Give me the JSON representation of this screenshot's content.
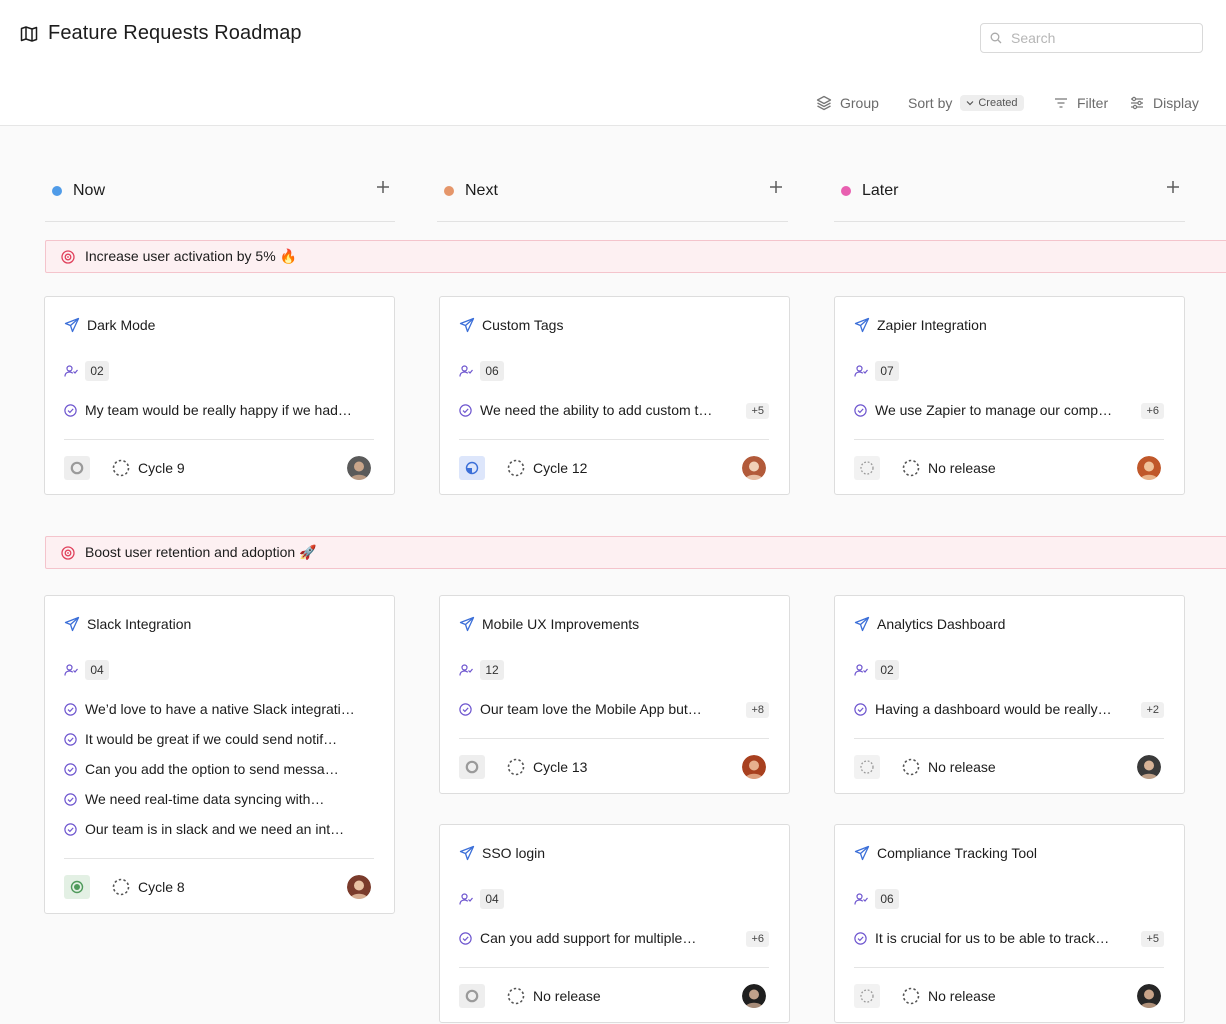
{
  "header": {
    "title": "Feature Requests Roadmap",
    "search_placeholder": "Search"
  },
  "toolbar": {
    "group": "Group",
    "sort_by": "Sort by",
    "sort_value": "Created",
    "filter": "Filter",
    "display": "Display"
  },
  "columns": [
    {
      "name": "Now",
      "color": "#4f9be8"
    },
    {
      "name": "Next",
      "color": "#e5966a"
    },
    {
      "name": "Later",
      "color": "#e85fb0"
    }
  ],
  "goals": [
    {
      "label": "Increase user activation by 5% 🔥"
    },
    {
      "label": "Boost user retention and adoption 🚀"
    }
  ],
  "cards": [
    {
      "title": "Dark Mode",
      "votes": "02",
      "requests": [
        "My team would be really happy if we had…"
      ],
      "more": "",
      "cycle": "Cycle 9",
      "status": "grey"
    },
    {
      "title": "Custom Tags",
      "votes": "06",
      "requests": [
        "We need the ability to add custom t…"
      ],
      "more": "+5",
      "cycle": "Cycle 12",
      "status": "blue"
    },
    {
      "title": "Zapier Integration",
      "votes": "07",
      "requests": [
        "We use Zapier to manage our comp…"
      ],
      "more": "+6",
      "cycle": "No release",
      "status": "dashed"
    },
    {
      "title": "Slack Integration",
      "votes": "04",
      "requests": [
        "We’d love to have a native Slack integrati…",
        "It would be great if we could send notif…",
        "Can you add the option to send messa…",
        "We need real-time data syncing with…",
        "Our team is in slack and we need an int…"
      ],
      "more": "",
      "cycle": "Cycle 8",
      "status": "green"
    },
    {
      "title": "Mobile UX Improvements",
      "votes": "12",
      "requests": [
        "Our team love the Mobile App but…"
      ],
      "more": "+8",
      "cycle": "Cycle 13",
      "status": "grey"
    },
    {
      "title": "Analytics Dashboard",
      "votes": "02",
      "requests": [
        "Having a dashboard would be really…"
      ],
      "more": "+2",
      "cycle": "No release",
      "status": "dashed"
    },
    {
      "title": "SSO login",
      "votes": "04",
      "requests": [
        "Can you add support for multiple…"
      ],
      "more": "+6",
      "cycle": "No release",
      "status": "grey"
    },
    {
      "title": "Compliance Tracking Tool",
      "votes": "06",
      "requests": [
        "It is crucial for us to be able to track…"
      ],
      "more": "+5",
      "cycle": "No release",
      "status": "dashed"
    }
  ],
  "colors": {
    "accent_purple": "#6e56cf",
    "feature_blue": "#3b6fd8",
    "goal_red": "#e0415c"
  }
}
